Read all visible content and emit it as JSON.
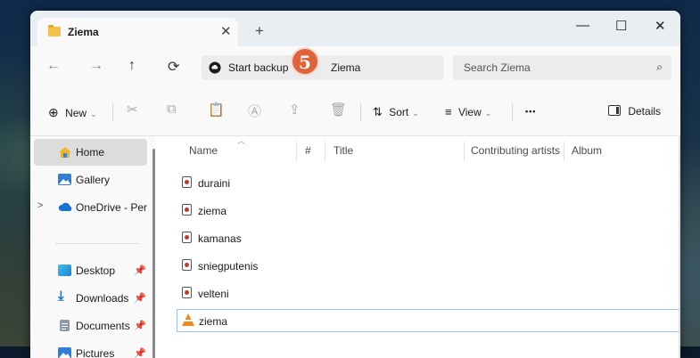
{
  "tab": {
    "title": "Ziema",
    "close": "✕",
    "new": "+"
  },
  "window_controls": {
    "minimize": "—",
    "maximize": "☐",
    "close": "✕"
  },
  "nav_buttons": {
    "back": "←",
    "forward": "→",
    "up": "↑",
    "refresh": "⟳"
  },
  "address": {
    "backup_label": "Start backup",
    "crumb": "Ziema",
    "annotation_badge": "5"
  },
  "search": {
    "placeholder": "Search Ziema",
    "icon": "⌕"
  },
  "toolbar": {
    "new_label": "New",
    "sort_label": "Sort",
    "view_label": "View",
    "more_label": "•••",
    "details_label": "Details"
  },
  "sidebar": {
    "items": [
      {
        "label": "Home",
        "icon": "home-icon",
        "color": "#f0b429",
        "selected": true
      },
      {
        "label": "Gallery",
        "icon": "gallery-icon",
        "color": "#2f7fd6"
      },
      {
        "label": "OneDrive - Perso",
        "icon": "onedrive-icon",
        "color": "#1a73d8",
        "expander": ">"
      },
      {
        "label": "Desktop",
        "icon": "desktop-icon",
        "color": "#2aa5e8",
        "pinned": true
      },
      {
        "label": "Downloads",
        "icon": "download-icon",
        "color": "#1c6fd1",
        "pinned": true
      },
      {
        "label": "Documents",
        "icon": "documents-icon",
        "color": "#8a9aaa",
        "pinned": true
      },
      {
        "label": "Pictures",
        "icon": "pictures-icon",
        "color": "#2f7fd6",
        "pinned": true
      }
    ]
  },
  "columns": {
    "name": "Name",
    "number": "#",
    "title": "Title",
    "artists": "Contributing artists",
    "album": "Album"
  },
  "files": [
    {
      "name": "duraini",
      "icon": "audio-file-icon"
    },
    {
      "name": "ziema",
      "icon": "audio-file-icon"
    },
    {
      "name": "kamanas",
      "icon": "audio-file-icon"
    },
    {
      "name": "sniegputenis",
      "icon": "audio-file-icon"
    },
    {
      "name": "velteni",
      "icon": "audio-file-icon"
    },
    {
      "name": "ziema",
      "icon": "vlc-icon",
      "selected": true
    }
  ],
  "colors": {
    "accent": "#0067c0",
    "badge": "#e2623a",
    "selection_border": "#9cc1e8"
  }
}
